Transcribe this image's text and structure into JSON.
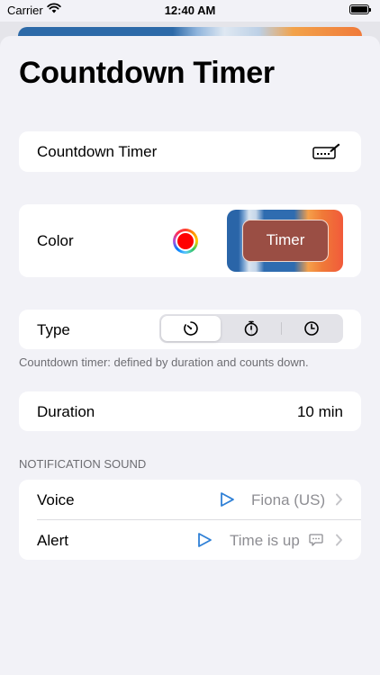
{
  "status_bar": {
    "carrier": "Carrier",
    "time": "12:40 AM"
  },
  "page": {
    "title": "Countdown Timer"
  },
  "name_row": {
    "value": "Countdown Timer",
    "icon": "keyboard-icon"
  },
  "color_row": {
    "label": "Color",
    "selected_color": "#ff0000",
    "preview_label": "Timer",
    "preview_button_color": "#9a4e44"
  },
  "type_row": {
    "label": "Type",
    "segments": [
      {
        "icon": "countdown-timer-icon",
        "selected": true
      },
      {
        "icon": "stopwatch-icon",
        "selected": false
      },
      {
        "icon": "clock-icon",
        "selected": false
      }
    ],
    "footnote": "Countdown timer: defined by duration and counts down."
  },
  "duration_row": {
    "label": "Duration",
    "value": "10 min"
  },
  "notification_sound": {
    "header": "NOTIFICATION SOUND",
    "voice": {
      "label": "Voice",
      "value": "Fiona (US)"
    },
    "alert": {
      "label": "Alert",
      "value": "Time is up"
    }
  },
  "colors": {
    "accent": "#2f80d6",
    "secondary_text": "#8e8e93",
    "background": "#f2f2f7"
  }
}
